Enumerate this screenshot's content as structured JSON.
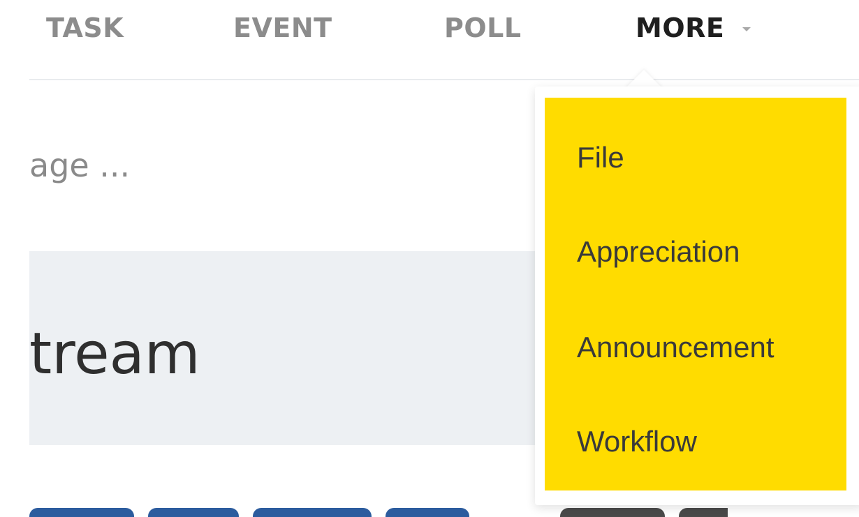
{
  "tabs": {
    "task": "TASK",
    "event": "EVENT",
    "poll": "POLL",
    "more": "MORE"
  },
  "composer": {
    "placeholder_fragment": "age ..."
  },
  "stream": {
    "title_fragment": "tream"
  },
  "more_menu": {
    "items": [
      "File",
      "Appreciation",
      "Announcement",
      "Workflow"
    ]
  },
  "colors": {
    "menu_highlight": "#ffdc00",
    "active_tab": "#1f1f1f",
    "inactive_tab": "#8c8c8c",
    "stream_band": "#edf0f3",
    "link_blue": "#2c5c9e"
  },
  "icons": {
    "more_caret": "chevron-down-icon"
  }
}
